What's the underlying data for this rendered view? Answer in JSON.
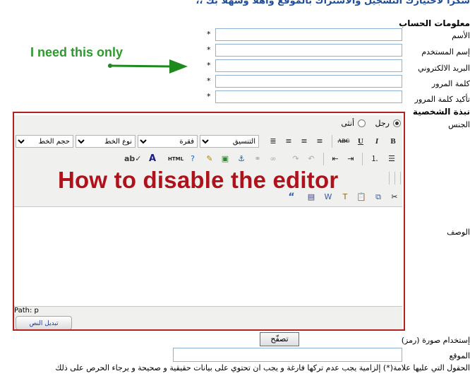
{
  "page": {
    "title": "شكراً لأختيارك التسجيل والأشتراك بالموقع وأهلاً وسهلاً بك ،،",
    "account_section": "معلومات الحساب",
    "fields": [
      {
        "label": "الأسم",
        "required": "*",
        "value": ""
      },
      {
        "label": "إسم المستخدم",
        "required": "*",
        "value": ""
      },
      {
        "label": "البريد الالكتروني",
        "required": "*",
        "value": ""
      },
      {
        "label": "كلمة المرور",
        "required": "*",
        "value": ""
      },
      {
        "label": "تأكيد كلمة المرور",
        "required": "*",
        "value": ""
      }
    ],
    "personal_section": "نبذة الشخصية",
    "gender_label": "الجنس",
    "gender_options": [
      "رجل",
      "أنثى"
    ],
    "gender_selected": "رجل",
    "description_label": "الوصف",
    "image_label": "إستخدام صورة (رمز)",
    "browse_label": "تصفّح",
    "website_label": "الموقع",
    "footer_note": "الحقول التي عليها علامة(*) إلزامية يجب عدم تركها فارغة و يجب ان تحتوي على بيانات حقيقية و صحيحة و يرجاء الحرص على ذلك"
  },
  "annotations": {
    "need_text": "I need this only",
    "disable_text": "How to disable the editor"
  },
  "editor": {
    "dropdowns": {
      "format": "التنسيق",
      "paragraph": "فقرة",
      "font_family": "نوع الخط",
      "font_size": "حجم الخط"
    },
    "path_label": "Path:",
    "path_value": "p",
    "toggle_label": "تبديل النص",
    "toolbar_row1": [
      "B",
      "I",
      "U",
      "ABC"
    ],
    "html_label": "HTML"
  },
  "colors": {
    "title_blue": "#1f4f9a",
    "annotation_green": "#2e9a2e",
    "annotation_red": "#b0121b",
    "editor_border": "#b22222"
  }
}
